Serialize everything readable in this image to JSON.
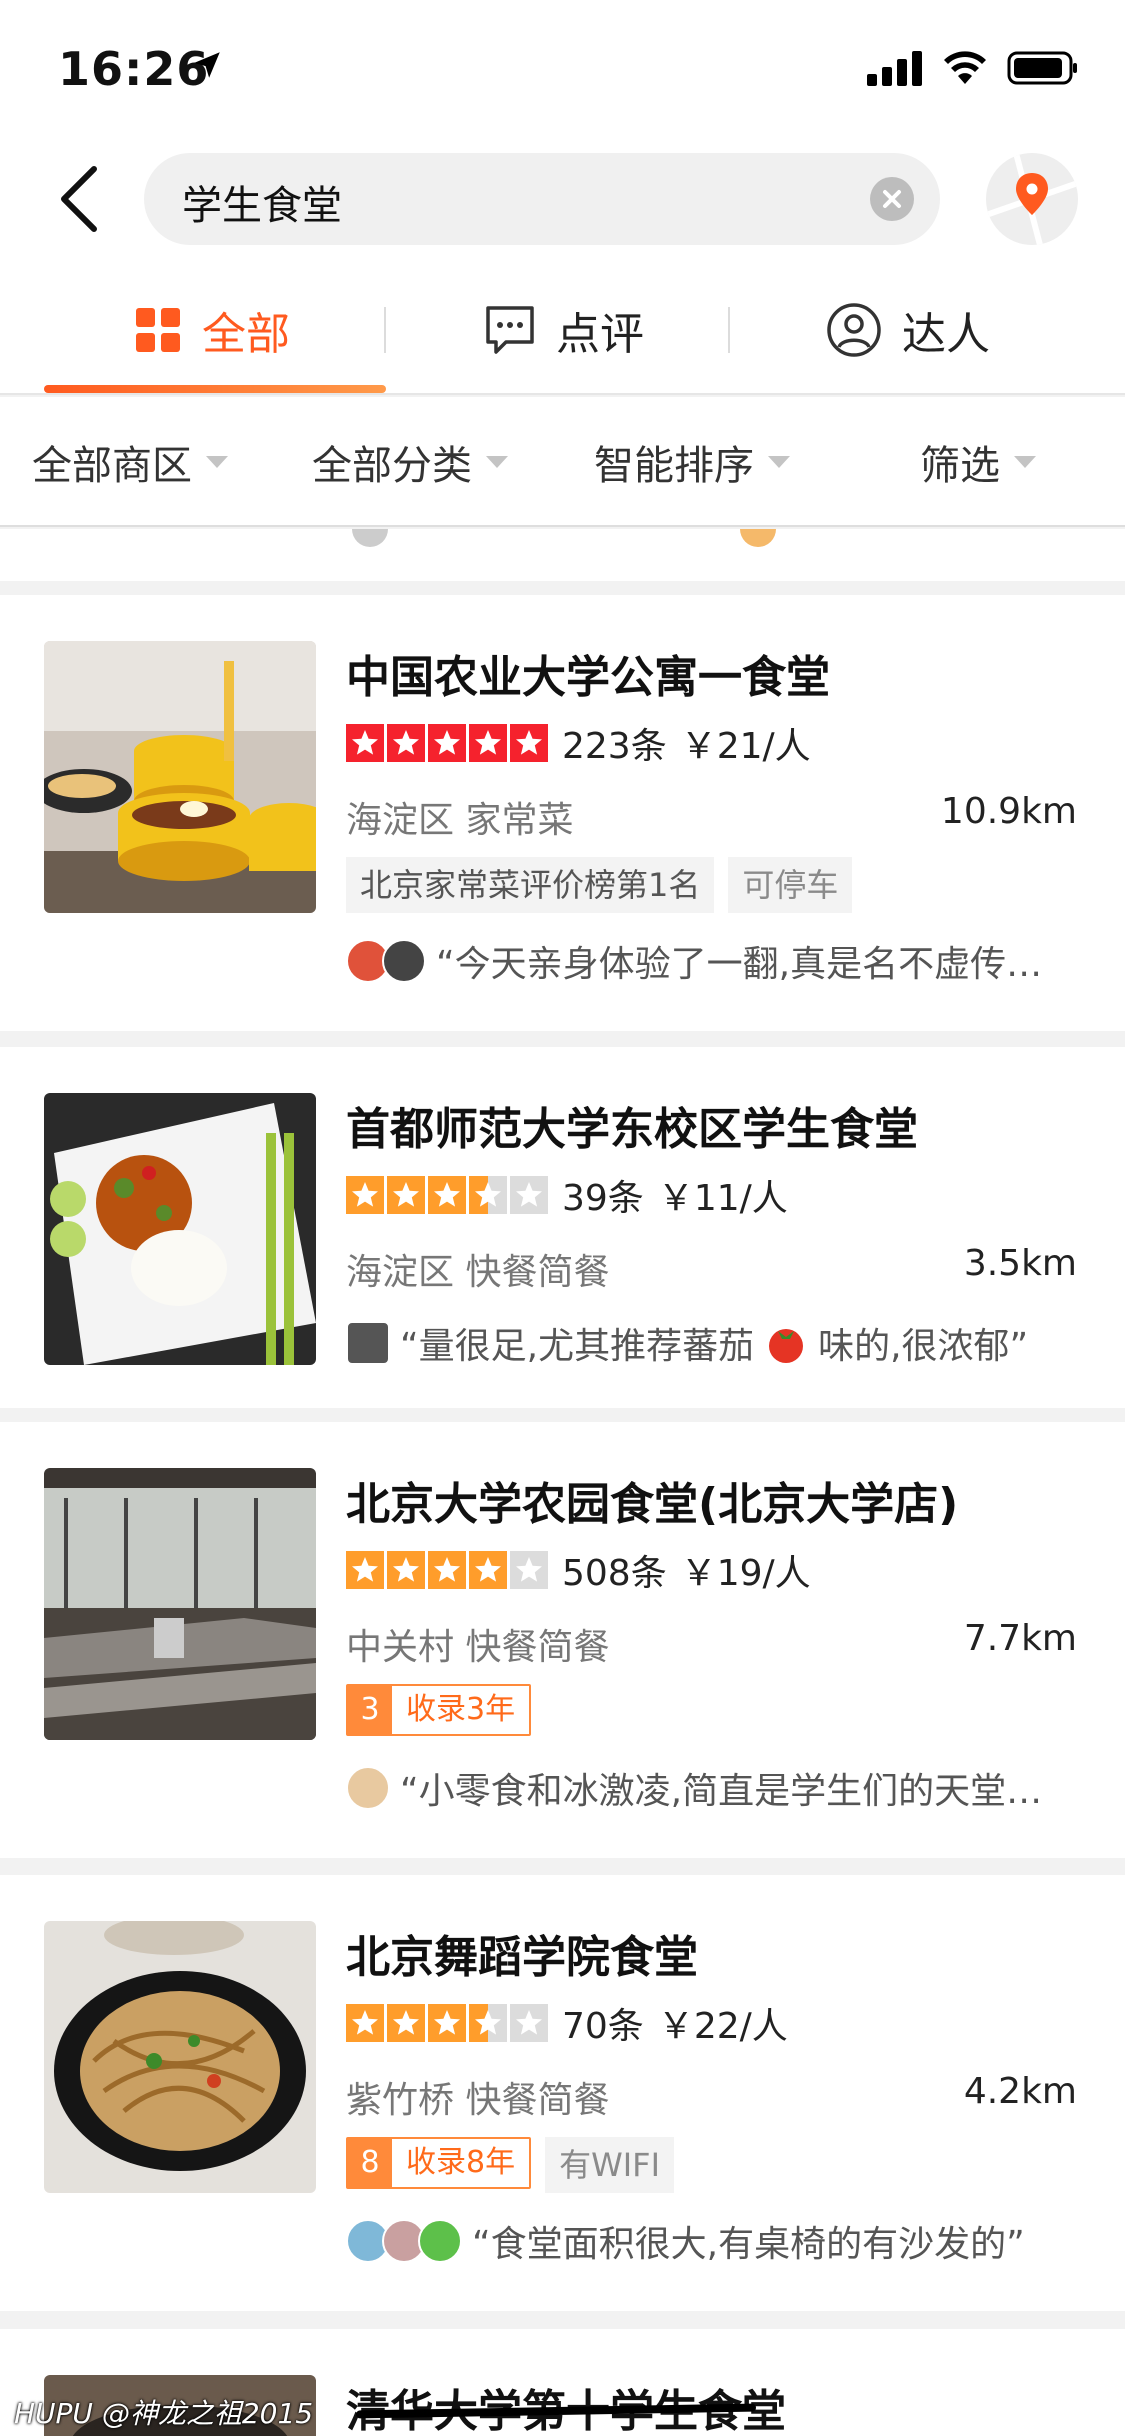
{
  "status_bar": {
    "time": "16:26"
  },
  "search": {
    "query": "学生食堂"
  },
  "tabs": [
    {
      "label": "全部"
    },
    {
      "label": "点评"
    },
    {
      "label": "达人"
    }
  ],
  "filters": [
    {
      "label": "全部商区"
    },
    {
      "label": "全部分类"
    },
    {
      "label": "智能排序"
    },
    {
      "label": "筛选"
    }
  ],
  "colors": {
    "accent": "#ff5a1f",
    "star_red": "#f5222d",
    "star_orange": "#ff9d2b",
    "tag_orange": "#ff8a3a"
  },
  "results": [
    {
      "name": "中国农业大学公寓一食堂",
      "stars": 5,
      "star_color": "red",
      "reviews": "223条",
      "price": "￥21/人",
      "region": "海淀区  家常菜",
      "distance": "10.9km",
      "tags": [
        "北京家常菜评价榜第1名",
        "可停车"
      ],
      "review_snippet": "“今天亲身体验了一翻,真是名不虚传…"
    },
    {
      "name": "首都师范大学东校区学生食堂",
      "stars": 3.5,
      "star_color": "orange",
      "reviews": "39条",
      "price": "￥11/人",
      "region": "海淀区  快餐简餐",
      "distance": "3.5km",
      "tags": [],
      "review_snippet_a": "“量很足,尤其推荐蕃茄",
      "review_snippet_b": "味的,很浓郁”"
    },
    {
      "name": "北京大学农园食堂(北京大学店)",
      "stars": 4,
      "star_color": "orange",
      "reviews": "508条",
      "price": "￥19/人",
      "region": "中关村  快餐简餐",
      "distance": "7.7km",
      "years_num": "3",
      "years_text": "收录3年",
      "review_snippet": "“小零食和冰激凌,简直是学生们的天堂…"
    },
    {
      "name": "北京舞蹈学院食堂",
      "stars": 3.5,
      "star_color": "orange",
      "reviews": "70条",
      "price": "￥22/人",
      "region": "紫竹桥  快餐简餐",
      "distance": "4.2km",
      "years_num": "8",
      "years_text": "收录8年",
      "extra_tag": "有WIFI",
      "review_snippet": "“食堂面积很大,有桌椅的有沙发的”"
    },
    {
      "name": "清华大学第十学生食堂"
    }
  ],
  "watermark": "HUPU @神龙之祖2015"
}
